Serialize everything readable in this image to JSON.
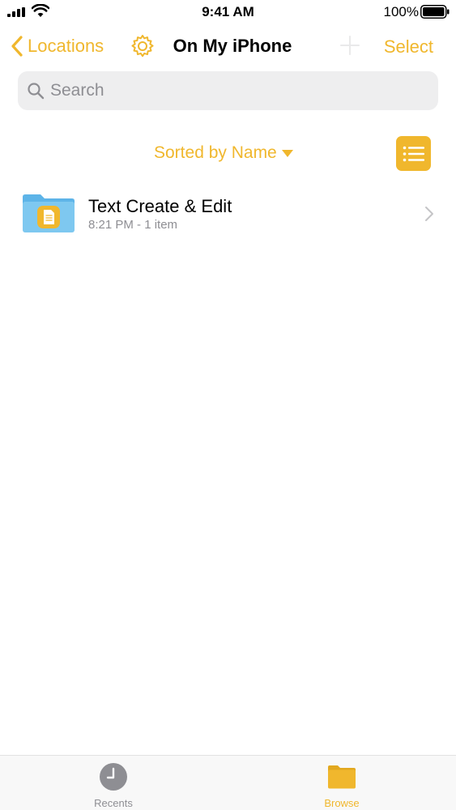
{
  "status_bar": {
    "time": "9:41 AM",
    "battery_percent": "100%",
    "signal_icon": "cellular-signal-icon",
    "wifi_icon": "wifi-icon",
    "battery_icon": "battery-full-icon"
  },
  "nav": {
    "back_label": "Locations",
    "back_icon": "chevron-left-icon",
    "settings_icon": "gear-icon",
    "title": "On My iPhone",
    "add_icon": "plus-icon",
    "select_label": "Select"
  },
  "search": {
    "placeholder": "Search",
    "value": "",
    "icon": "magnifying-glass-icon"
  },
  "sort": {
    "label": "Sorted by Name",
    "caret_icon": "caret-down-icon",
    "view_toggle_icon": "list-view-icon"
  },
  "files": [
    {
      "name": "Text Create & Edit",
      "meta": "8:21 PM - 1 item",
      "icon": "folder-icon",
      "chevron_icon": "chevron-right-icon"
    }
  ],
  "tabs": [
    {
      "label": "Recents",
      "icon": "clock-icon",
      "active": false
    },
    {
      "label": "Browse",
      "icon": "folder-icon",
      "active": true
    }
  ],
  "colors": {
    "accent": "#F0B72D",
    "secondary_text": "#8E8E93",
    "search_background": "#EEEEEF",
    "folder_blue": "#7EC8F0"
  }
}
